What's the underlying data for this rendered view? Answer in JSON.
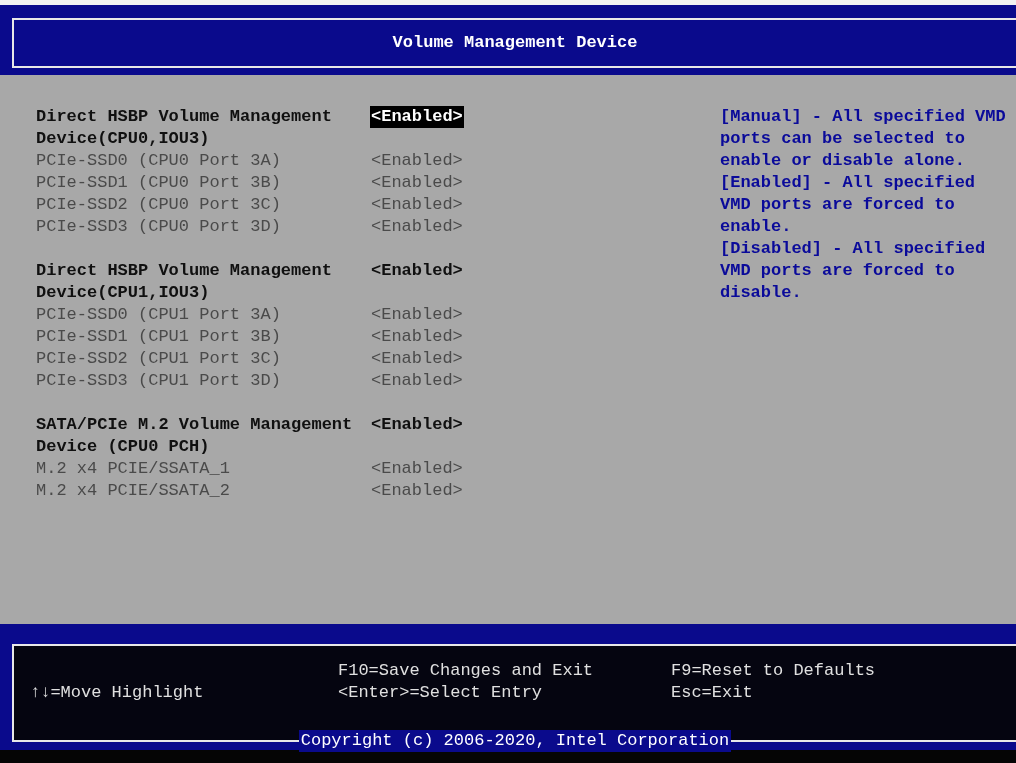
{
  "title": "Volume Management Device",
  "groups": [
    {
      "items": [
        {
          "kind": "setting",
          "label": "Direct HSBP Volume Management Device(CPU0,IOU3)",
          "value": "<Enabled>",
          "selected": true
        },
        {
          "kind": "sub",
          "label": "PCIe-SSD0 (CPU0 Port 3A)",
          "value": "<Enabled>",
          "selected": false
        },
        {
          "kind": "sub",
          "label": "PCIe-SSD1 (CPU0 Port 3B)",
          "value": "<Enabled>",
          "selected": false
        },
        {
          "kind": "sub",
          "label": "PCIe-SSD2 (CPU0 Port 3C)",
          "value": "<Enabled>",
          "selected": false
        },
        {
          "kind": "sub",
          "label": "PCIe-SSD3 (CPU0 Port 3D)",
          "value": "<Enabled>",
          "selected": false
        }
      ]
    },
    {
      "items": [
        {
          "kind": "setting",
          "label": "Direct HSBP Volume Management Device(CPU1,IOU3)",
          "value": "<Enabled>",
          "selected": false
        },
        {
          "kind": "sub",
          "label": "PCIe-SSD0 (CPU1 Port 3A)",
          "value": "<Enabled>",
          "selected": false
        },
        {
          "kind": "sub",
          "label": "PCIe-SSD1 (CPU1 Port 3B)",
          "value": "<Enabled>",
          "selected": false
        },
        {
          "kind": "sub",
          "label": "PCIe-SSD2 (CPU1 Port 3C)",
          "value": "<Enabled>",
          "selected": false
        },
        {
          "kind": "sub",
          "label": "PCIe-SSD3 (CPU1 Port 3D)",
          "value": "<Enabled>",
          "selected": false
        }
      ]
    },
    {
      "items": [
        {
          "kind": "setting",
          "label": "SATA/PCIe M.2 Volume Management Device (CPU0 PCH)",
          "value": "<Enabled>",
          "selected": false
        },
        {
          "kind": "sub",
          "label": "M.2 x4 PCIE/SSATA_1",
          "value": "<Enabled>",
          "selected": false
        },
        {
          "kind": "sub",
          "label": "M.2 x4 PCIE/SSATA_2",
          "value": "<Enabled>",
          "selected": false
        }
      ]
    }
  ],
  "help": [
    "[Manual] - All specified VMD ports can be selected to enable or disable alone.",
    "[Enabled] - All specified VMD ports are forced to enable.",
    "[Disabled] - All specified VMD ports are forced to disable."
  ],
  "footer": {
    "columns": [
      {
        "lines": [
          "↑↓=Move Highlight"
        ]
      },
      {
        "lines": [
          "F10=Save Changes and Exit",
          "<Enter>=Select Entry"
        ]
      },
      {
        "lines": [
          "F9=Reset to Defaults",
          "Esc=Exit"
        ]
      }
    ],
    "copyright": "Copyright (c) 2006-2020, Intel Corporation"
  }
}
